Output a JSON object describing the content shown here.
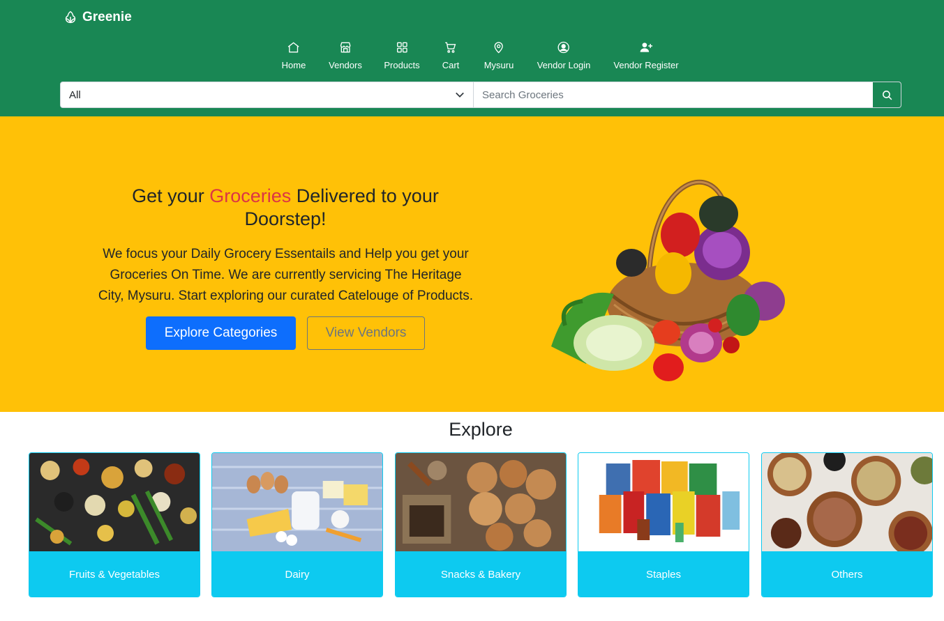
{
  "brand": {
    "name": "Greenie",
    "icon": "leaf-icon"
  },
  "nav": [
    {
      "label": "Home",
      "icon": "home-icon"
    },
    {
      "label": "Vendors",
      "icon": "shop-icon"
    },
    {
      "label": "Products",
      "icon": "grid-icon"
    },
    {
      "label": "Cart",
      "icon": "cart-icon"
    },
    {
      "label": "Mysuru",
      "icon": "location-pin-icon"
    },
    {
      "label": "Vendor Login",
      "icon": "user-circle-icon"
    },
    {
      "label": "Vendor Register",
      "icon": "user-plus-icon"
    }
  ],
  "search": {
    "category_selected": "All",
    "placeholder": "Search Groceries",
    "value": ""
  },
  "hero": {
    "title_part1": "Get your ",
    "title_accent": "Groceries",
    "title_part2": " Delivered to your Doorstep!",
    "text": "We focus your Daily Grocery Essentails and Help you get your Groceries On Time. We are currently servicing The Heritage City, Mysuru. Start exploring our curated Catelouge of Products.",
    "primary_button": "Explore Categories",
    "secondary_button": "View Vendors"
  },
  "explore": {
    "title": "Explore",
    "categories": [
      {
        "label": "Fruits & Vegetables"
      },
      {
        "label": "Dairy"
      },
      {
        "label": "Snacks & Bakery"
      },
      {
        "label": "Staples"
      },
      {
        "label": "Others"
      }
    ]
  },
  "colors": {
    "navbar": "#198754",
    "hero_bg": "#ffc107",
    "accent_text": "#dc3545",
    "primary_button": "#0d6efd",
    "card_label": "#0dcaf0"
  }
}
